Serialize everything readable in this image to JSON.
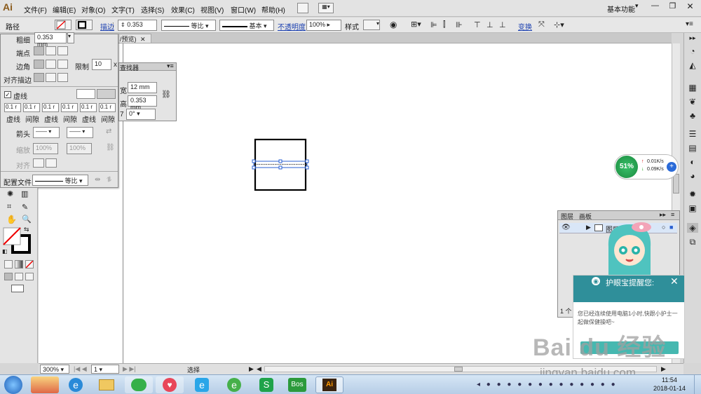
{
  "menubar": {
    "logo": "Ai",
    "items": [
      "文件(F)",
      "编辑(E)",
      "对象(O)",
      "文字(T)",
      "选择(S)",
      "效果(C)",
      "视图(V)",
      "窗口(W)",
      "帮助(H)"
    ],
    "workspace": "基本功能"
  },
  "control": {
    "mode": "路径",
    "stroke_link": "描边",
    "stroke_value": "0.353",
    "profile1": "等比",
    "profile2": "基本",
    "opacity_link": "不透明度",
    "opacity_value": "100%",
    "style_label": "样式",
    "transform_link": "变换"
  },
  "doc_tab": "/预览)",
  "stroke_panel": {
    "weight_label": "粗细",
    "weight_value": "0.353 mm",
    "cap_label": "端点",
    "corner_label": "边角",
    "limit_label": "限制",
    "limit_value": "10",
    "limit_unit": "x",
    "align_label": "对齐描边",
    "dashed_label": "虚线",
    "dash_values": [
      "0.1 r",
      "0.1 r",
      "0.1 r",
      "0.1 r",
      "0.1 r",
      "0.1 r"
    ],
    "dash_labels": [
      "虚线",
      "间隙",
      "虚线",
      "间隙",
      "虚线",
      "间隙"
    ],
    "arrow_label": "箭头",
    "scale_label": "缩放",
    "scale1": "100%",
    "scale2": "100%",
    "align2_label": "对齐",
    "profile_label": "配置文件",
    "profile_value": "等比"
  },
  "transform_panel": {
    "title": "查找器",
    "w_label": "宽",
    "w_value": "12 mm",
    "h_label": "高",
    "h_value": "0.353 mm",
    "angle_label": "7",
    "angle_value": "0°"
  },
  "layers_panel": {
    "tab1": "图层",
    "tab2": "画板",
    "layer_name": "图层",
    "footer": "1 个"
  },
  "status": {
    "zoom": "300%",
    "page": "1",
    "tool": "选择"
  },
  "net": {
    "percent": "51%",
    "up": "0.01K/s",
    "down": "0.09K/s"
  },
  "popup": {
    "title": "护眼宝提醒您:",
    "message": "您已经连续使用电脑1小时,快跟小护士一起做保健操吧~"
  },
  "taskbar": {
    "time": "11:54",
    "date": "2018-01-14",
    "bos": "Bos",
    "ai": "Ai"
  },
  "watermark": {
    "brand": "Bai du 经验",
    "url": "jingyan.baidu.com"
  }
}
